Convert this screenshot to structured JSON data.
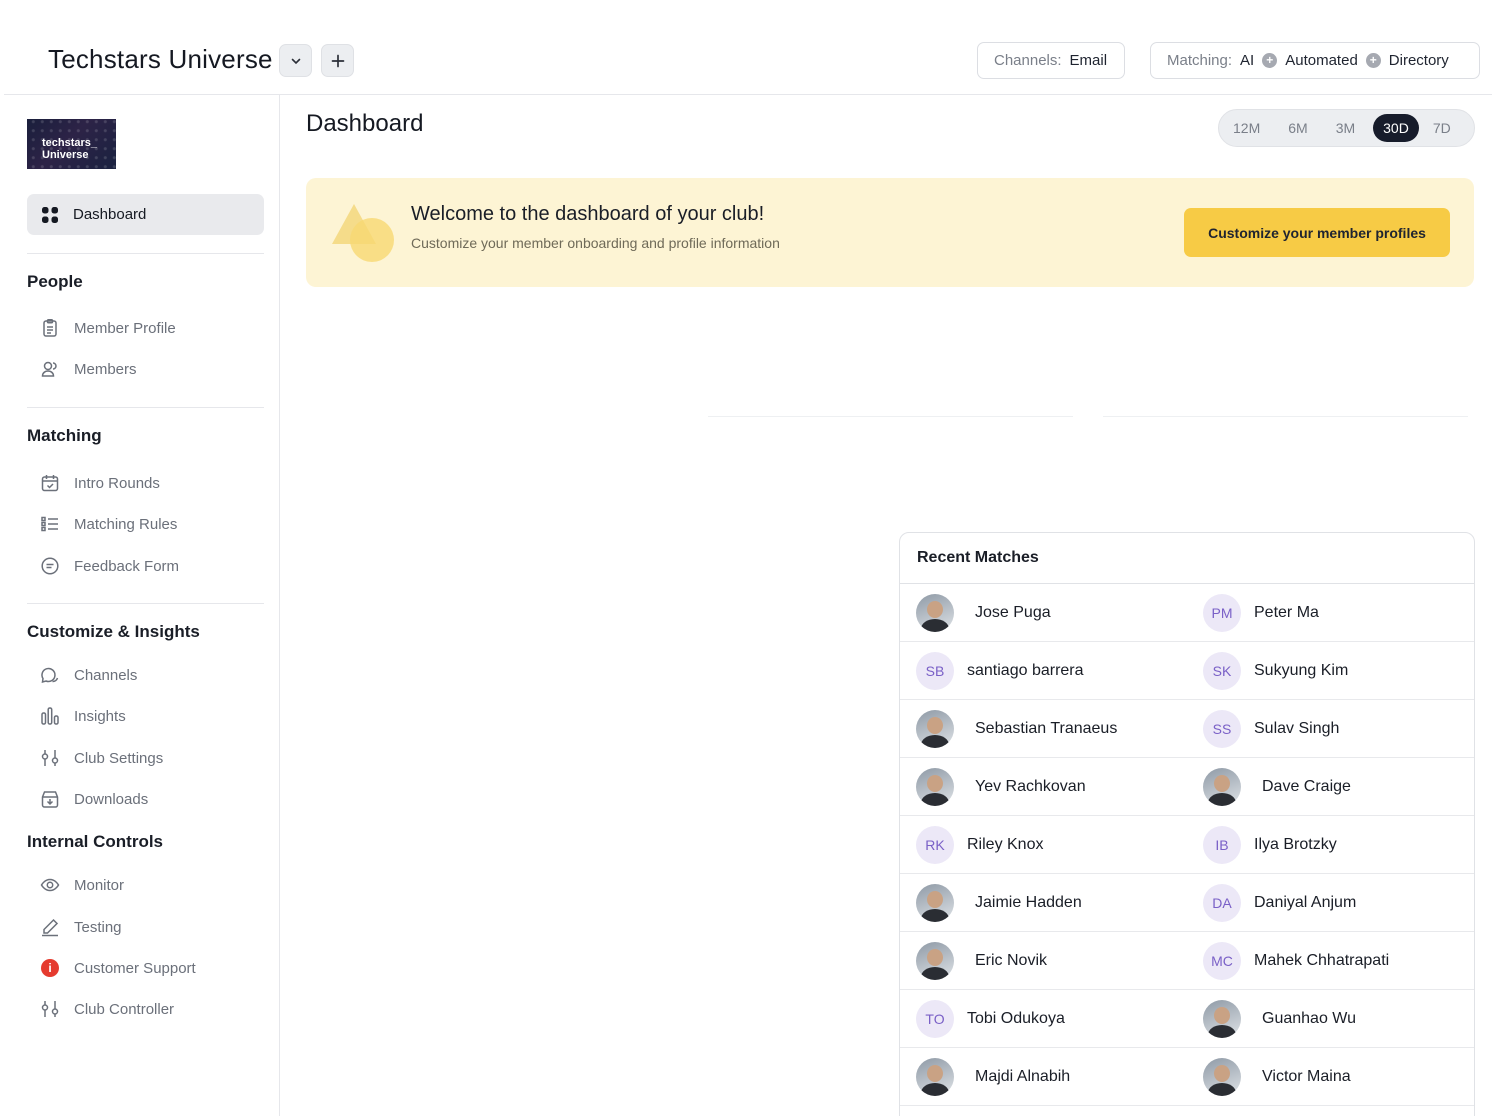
{
  "header": {
    "title": "Techstars Universe",
    "channels_label": "Channels:",
    "channels_value": "Email",
    "matching_label": "Matching:",
    "matching_values": [
      "AI",
      "Automated",
      "Directory"
    ]
  },
  "sidebar": {
    "logo_text": [
      "techstars_",
      "Universe"
    ],
    "active": "Dashboard",
    "sections": [
      {
        "title": "People",
        "items": [
          "Member Profile",
          "Members"
        ]
      },
      {
        "title": "Matching",
        "items": [
          "Intro Rounds",
          "Matching Rules",
          "Feedback Form"
        ]
      },
      {
        "title": "Customize & Insights",
        "items": [
          "Channels",
          "Insights",
          "Club Settings",
          "Downloads"
        ]
      },
      {
        "title": "Internal Controls",
        "items": [
          "Monitor",
          "Testing",
          "Customer Support",
          "Club Controller"
        ]
      }
    ]
  },
  "main": {
    "title": "Dashboard",
    "ranges": [
      "12M",
      "6M",
      "3M",
      "30D",
      "7D"
    ],
    "active_range": "30D",
    "banner": {
      "title": "Welcome to the dashboard of your club!",
      "subtitle": "Customize your member onboarding and profile information",
      "cta": "Customize your member profiles"
    }
  },
  "matches": {
    "title": "Recent Matches",
    "rows": [
      [
        {
          "name": "Jose Puga",
          "avatar": "photo"
        },
        {
          "name": "Peter Ma",
          "avatar": "PM"
        }
      ],
      [
        {
          "name": "santiago barrera",
          "avatar": "SB"
        },
        {
          "name": "Sukyung Kim",
          "avatar": "SK"
        }
      ],
      [
        {
          "name": "Sebastian Tranaeus",
          "avatar": "photo"
        },
        {
          "name": "Sulav Singh",
          "avatar": "SS"
        }
      ],
      [
        {
          "name": "Yev Rachkovan",
          "avatar": "photo"
        },
        {
          "name": "Dave Craige",
          "avatar": "photo"
        }
      ],
      [
        {
          "name": "Riley Knox",
          "avatar": "RK"
        },
        {
          "name": "Ilya Brotzky",
          "avatar": "IB"
        }
      ],
      [
        {
          "name": "Jaimie Hadden",
          "avatar": "photo"
        },
        {
          "name": "Daniyal Anjum",
          "avatar": "DA"
        }
      ],
      [
        {
          "name": "Eric Novik",
          "avatar": "photo"
        },
        {
          "name": "Mahek Chhatrapati",
          "avatar": "MC"
        }
      ],
      [
        {
          "name": "Tobi Odukoya",
          "avatar": "TO"
        },
        {
          "name": "Guanhao Wu",
          "avatar": "photo"
        }
      ],
      [
        {
          "name": "Majdi Alnabih",
          "avatar": "photo"
        },
        {
          "name": "Victor Maina",
          "avatar": "photo"
        }
      ]
    ]
  }
}
